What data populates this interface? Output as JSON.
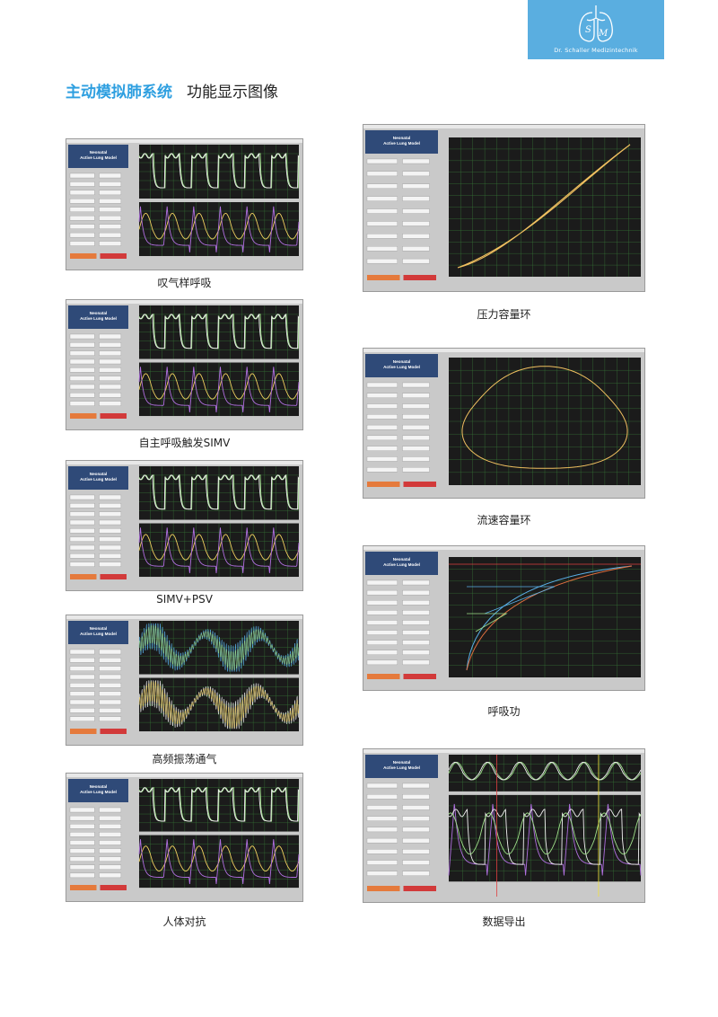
{
  "brand": {
    "logo_letters": "SM",
    "logo_text": "Dr. Schaller Medizintechnik"
  },
  "heading": {
    "accent": "主动模拟肺系统",
    "rest": "功能显示图像"
  },
  "panel_title": "Neonatal Active Lung Model",
  "panel_line1": "Neonatal",
  "panel_line2": "Active Lung Model",
  "screens": [
    {
      "caption": "叹气样呼吸",
      "kind": "waves"
    },
    {
      "caption": "自主呼吸触发SIMV",
      "kind": "waves"
    },
    {
      "caption": "SIMV+PSV",
      "kind": "waves"
    },
    {
      "caption": "高频振荡通气",
      "kind": "hfo"
    },
    {
      "caption": "人体对抗",
      "kind": "waves"
    },
    {
      "caption": "压力容量环",
      "kind": "pv-loop"
    },
    {
      "caption": "流速容量环",
      "kind": "fv-loop"
    },
    {
      "caption": "呼吸功",
      "kind": "wob"
    },
    {
      "caption": "数据导出",
      "kind": "export"
    }
  ],
  "colors": {
    "accent": "#2e9fe0",
    "plot_bg": "#1b1b1b",
    "grid": "#3c8a3c",
    "trace_green": "#9fe08a",
    "trace_white": "#f2f2f2",
    "trace_purple": "#b070e0",
    "trace_yellow": "#f0d060",
    "loop": "#f0c060"
  }
}
